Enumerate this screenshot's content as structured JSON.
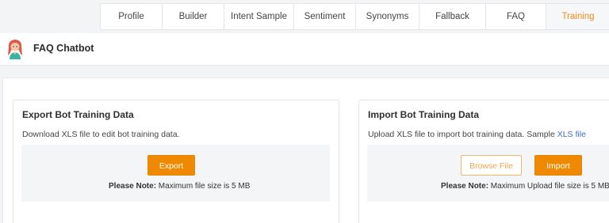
{
  "tabs": [
    {
      "label": "Profile"
    },
    {
      "label": "Builder"
    },
    {
      "label": "Intent Sample"
    },
    {
      "label": "Sentiment"
    },
    {
      "label": "Synonyms"
    },
    {
      "label": "Fallback"
    },
    {
      "label": "FAQ"
    },
    {
      "label": "Training"
    }
  ],
  "active_tab": "Training",
  "header": {
    "title": "FAQ Chatbot"
  },
  "export": {
    "title": "Export Bot Training Data",
    "description": "Download XLS file to edit bot training data.",
    "button": "Export",
    "note_label": "Please Note:",
    "note_text": " Maximum file size is 5 MB"
  },
  "import": {
    "title": "Import Bot Training Data",
    "description": "Upload XLS file to import bot training data. Sample ",
    "link": "XLS file",
    "browse_button": "Browse File",
    "import_button": "Import",
    "note_label": "Please Note:",
    "note_text": " Maximum Upload file size is 5 MB"
  },
  "colors": {
    "accent": "#ef8a00",
    "active_tab_text": "#ef8a1c",
    "link": "#3d6bc8"
  }
}
